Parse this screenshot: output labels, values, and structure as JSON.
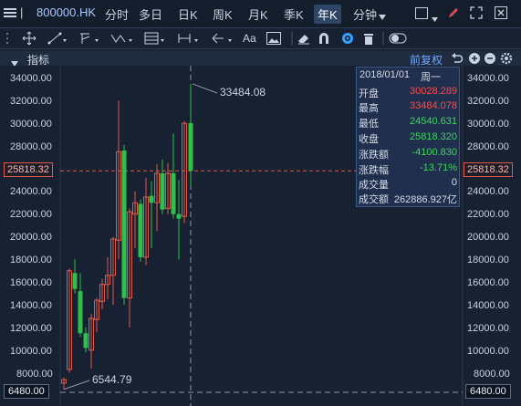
{
  "header": {
    "symbol": "800000.HK",
    "periods": [
      "分时",
      "多日",
      "日K",
      "周K",
      "月K",
      "季K",
      "年K",
      "分钟"
    ],
    "active_period": "年K"
  },
  "indicator_bar": {
    "label": "指标",
    "restore_label": "前复权"
  },
  "chart": {
    "y_ticks": [
      "34000.00",
      "32000.00",
      "30000.00",
      "28000.00",
      "26000.00",
      "24000.00",
      "22000.00",
      "20000.00",
      "18000.00",
      "16000.00",
      "14000.00",
      "12000.00",
      "10000.00",
      "8000.00"
    ],
    "current_price": "25818.32",
    "high_marker": "33484.08",
    "low_marker": "6544.79",
    "bottom_value": "6480.00",
    "colors": {
      "up": "#e2594a",
      "down": "#2ec04b",
      "background": "#172132"
    }
  },
  "info_panel": {
    "date": "2018/01/01",
    "weekday": "周一",
    "rows": [
      {
        "label": "开盘",
        "value": "30028.289",
        "color": "#ff4a4a"
      },
      {
        "label": "最高",
        "value": "33484.078",
        "color": "#ff4a4a"
      },
      {
        "label": "最低",
        "value": "24540.631",
        "color": "#3fd460"
      },
      {
        "label": "收盘",
        "value": "25818.320",
        "color": "#3fd460"
      },
      {
        "label": "涨跌额",
        "value": "-4100.830",
        "color": "#3fd460"
      },
      {
        "label": "涨跌幅",
        "value": "-13.71%",
        "color": "#3fd460"
      },
      {
        "label": "成交量",
        "value": "0",
        "color": "#d6dde8"
      },
      {
        "label": "成交额",
        "value": "262886.927亿",
        "color": "#d6dde8"
      }
    ]
  }
}
